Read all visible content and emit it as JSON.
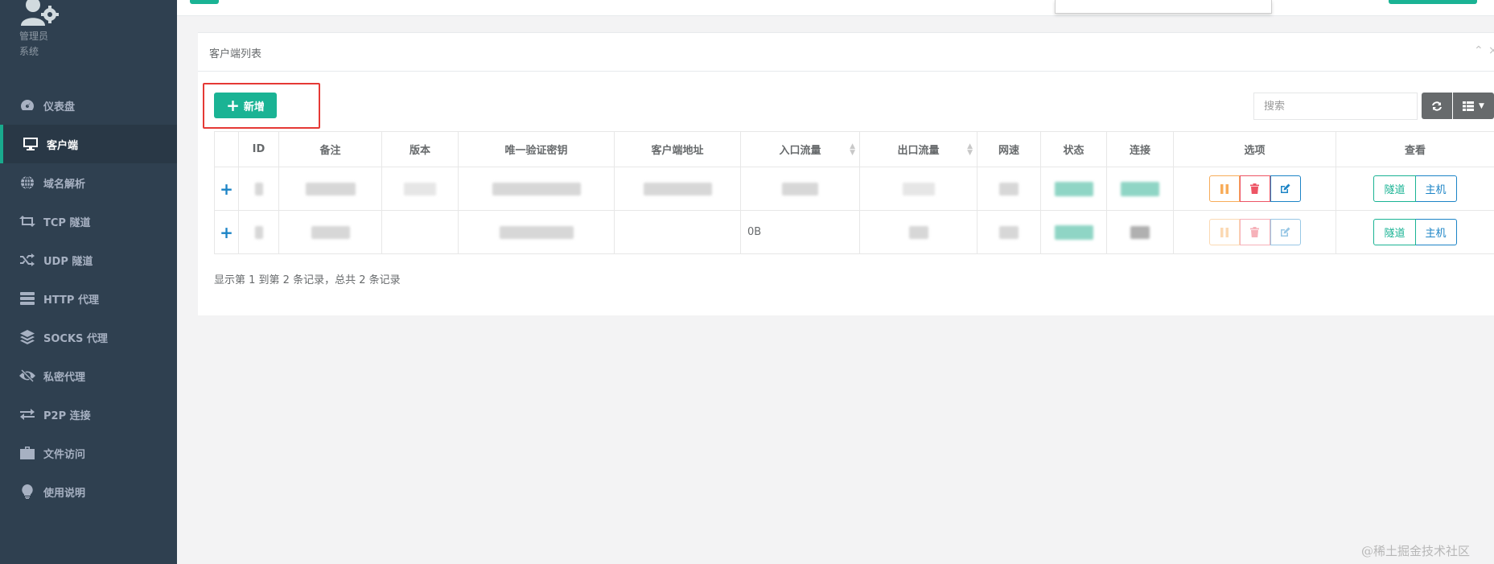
{
  "profile": {
    "role": "管理员",
    "system": "系统"
  },
  "nav": {
    "items": [
      {
        "label": "仪表盘",
        "icon": "dashboard-icon"
      },
      {
        "label": "客户端",
        "icon": "desktop-icon",
        "active": true
      },
      {
        "label": "域名解析",
        "icon": "globe-icon"
      },
      {
        "label": "TCP 隧道",
        "icon": "retweet-icon"
      },
      {
        "label": "UDP 隧道",
        "icon": "random-icon"
      },
      {
        "label": "HTTP 代理",
        "icon": "server-icon"
      },
      {
        "label": "SOCKS 代理",
        "icon": "layers-icon"
      },
      {
        "label": "私密代理",
        "icon": "eye-slash-icon"
      },
      {
        "label": "P2P 连接",
        "icon": "exchange-icon"
      },
      {
        "label": "文件访问",
        "icon": "briefcase-icon"
      },
      {
        "label": "使用说明",
        "icon": "lightbulb-icon"
      }
    ]
  },
  "panel": {
    "title": "客户端列表"
  },
  "toolbar": {
    "add_label": "新增",
    "search_placeholder": "搜索"
  },
  "table": {
    "headers": [
      "ID",
      "备注",
      "版本",
      "唯一验证密钥",
      "客户端地址",
      "入口流量",
      "出口流量",
      "网速",
      "状态",
      "连接",
      "选项",
      "查看"
    ],
    "row2_in_flow": "0B",
    "tunnel_label": "隧道",
    "host_label": "主机"
  },
  "pagination": {
    "text": "显示第 1 到第 2 条记录，总共 2 条记录"
  },
  "watermark": "@稀土掘金技术社区",
  "colors": {
    "sidebar": "#2f4050",
    "accent": "#1ab394",
    "primary": "#1c84c6",
    "warning": "#f8ac59",
    "danger": "#ed5565"
  }
}
